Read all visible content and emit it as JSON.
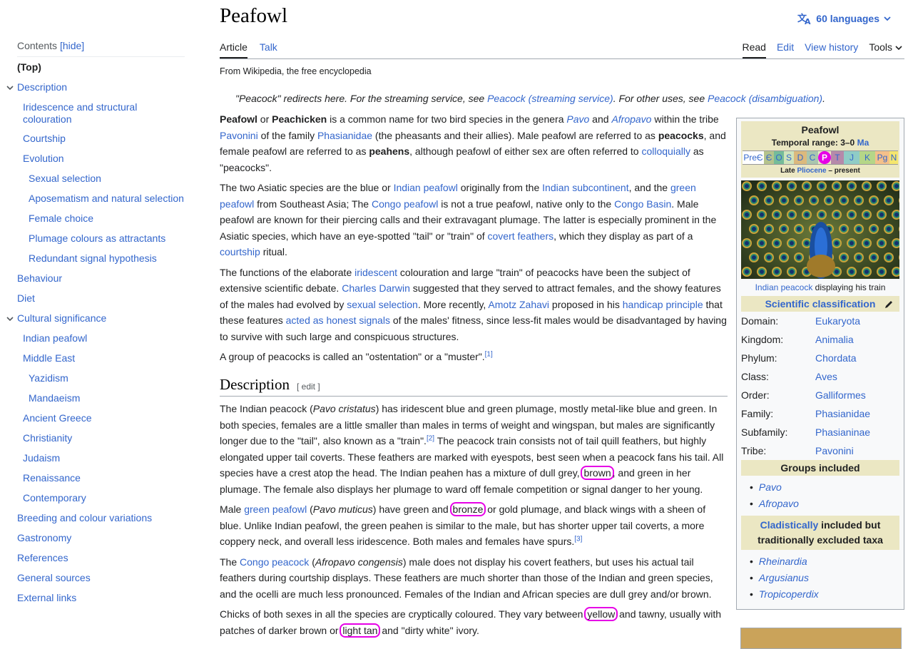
{
  "toc": {
    "heading": "Contents",
    "hide_label": "[hide]",
    "items": [
      {
        "label": "(Top)"
      },
      {
        "label": "Description"
      },
      {
        "label": "Iridescence and structural colouration"
      },
      {
        "label": "Courtship"
      },
      {
        "label": "Evolution"
      },
      {
        "label": "Sexual selection"
      },
      {
        "label": "Aposematism and natural selection"
      },
      {
        "label": "Female choice"
      },
      {
        "label": "Plumage colours as attractants"
      },
      {
        "label": "Redundant signal hypothesis"
      },
      {
        "label": "Behaviour"
      },
      {
        "label": "Diet"
      },
      {
        "label": "Cultural significance"
      },
      {
        "label": "Indian peafowl"
      },
      {
        "label": "Middle East"
      },
      {
        "label": "Yazidism"
      },
      {
        "label": "Mandaeism"
      },
      {
        "label": "Ancient Greece"
      },
      {
        "label": "Christianity"
      },
      {
        "label": "Judaism"
      },
      {
        "label": "Renaissance"
      },
      {
        "label": "Contemporary"
      },
      {
        "label": "Breeding and colour variations"
      },
      {
        "label": "Gastronomy"
      },
      {
        "label": "References"
      },
      {
        "label": "General sources"
      },
      {
        "label": "External links"
      }
    ]
  },
  "header": {
    "title": "Peafowl",
    "languages": "60 languages",
    "tabs_left": [
      "Article",
      "Talk"
    ],
    "tabs_right": [
      "Read",
      "Edit",
      "View history",
      "Tools"
    ],
    "tagline": "From Wikipedia, the free encyclopedia",
    "hatnote": {
      "a": "\"Peacock\" redirects here. For the streaming service, see ",
      "link1": "Peacock (streaming service)",
      "b": ". For other uses, see ",
      "link2": "Peacock (disambiguation)",
      "c": "."
    }
  },
  "article": {
    "p1": {
      "t1": "Peafowl",
      "t2": " or ",
      "t3": "Peachicken",
      "t4": " is a common name for two bird species in the genera ",
      "pavo": "Pavo",
      "t5": " and ",
      "afropavo": "Afropavo",
      "t6": " within the tribe ",
      "pavonini": "Pavonini",
      "t7": " of the family ",
      "phasianidae": "Phasianidae",
      "t8": " (the pheasants and their allies). Male peafowl are referred to as ",
      "peacocks": "peacocks",
      "t9": ", and female peafowl are referred to as ",
      "peahens": "peahens",
      "t10": ", although peafowl of either sex are often referred to ",
      "colloquially": "colloquially",
      "t11": " as \"peacocks\"."
    },
    "p2": {
      "t1": "The two Asiatic species are the blue or ",
      "indian_peafowl": "Indian peafowl",
      "t2": " originally from the ",
      "subcontinent": "Indian subcontinent",
      "t3": ", and the ",
      "green_peafowl": "green peafowl",
      "t4": " from Southeast Asia; The ",
      "congo_peafowl": "Congo peafowl",
      "t5": " is not a true peafowl, native only to the ",
      "congo_basin": "Congo Basin",
      "t6": ". Male peafowl are known for their piercing calls and their extravagant plumage. The latter is especially prominent in the Asiatic species, which have an eye-spotted \"tail\" or \"train\" of ",
      "covert": "covert feathers",
      "t7": ", which they display as part of a ",
      "courtship": "courtship",
      "t8": " ritual."
    },
    "p3": {
      "t1": "The functions of the elaborate ",
      "iridescent": "iridescent",
      "t2": " colouration and large \"train\" of peacocks have been the subject of extensive scientific debate. ",
      "darwin": "Charles Darwin",
      "t3": " suggested that they served to attract females, and the showy features of the males had evolved by ",
      "sexual_selection": "sexual selection",
      "t4": ". More recently, ",
      "zahavi": "Amotz Zahavi",
      "t5": " proposed in his ",
      "handicap": "handicap principle",
      "t6": " that these features ",
      "honest": "acted as honest signals",
      "t7": " of the males' fitness, since less-fit males would be disadvantaged by having to survive with such large and conspicuous structures."
    },
    "p4": {
      "t1": "A group of peacocks is called an \"ostentation\" or a \"muster\".",
      "ref": "[1]"
    },
    "description_heading": "Description",
    "edit_label": "[ edit ]",
    "d1": {
      "t1": "The Indian peacock (",
      "sci": "Pavo cristatus",
      "t2": ") has iridescent blue and green plumage, mostly metal-like blue and green. In both species, females are a little smaller than males in terms of weight and wingspan, but males are significantly longer due to the \"tail\", also known as a \"train\".",
      "ref": "[2]",
      "t3": " The peacock train consists not of tail quill feathers, but highly elongated upper tail coverts. These feathers are marked with eyespots, best seen when a peacock fans his tail. All species have a crest atop the head. The Indian peahen has a mixture of dull grey, ",
      "brown": "brown",
      "t4": ", and green in her plumage. The female also displays her plumage to ward off female competition or signal danger to her young."
    },
    "d2": {
      "t1": "Male ",
      "green": "green peafowl",
      "t2": " (",
      "sci": "Pavo muticus",
      "t3": ") have green and ",
      "bronze": "bronze",
      "t4": " or gold plumage, and black wings with a sheen of blue. Unlike Indian peafowl, the green peahen is similar to the male, but has shorter upper tail coverts, a more coppery neck, and overall less iridescence. Both males and females have spurs.",
      "ref": "[3]"
    },
    "d3": {
      "t1": "The ",
      "congo": "Congo peacock",
      "t2": " (",
      "sci": "Afropavo congensis",
      "t3": ") male does not display his covert feathers, but uses his actual tail feathers during courtship displays. These feathers are much shorter than those of the Indian and green species, and the ocelli are much less pronounced. Females of the Indian and African species are dull grey and/or brown."
    },
    "d4": {
      "t1": "Chicks of both sexes in all the species are cryptically coloured. They vary between ",
      "yellow": "yellow",
      "t2": " and tawny, usually with patches of darker brown or ",
      "light_tan": "light tan",
      "t3": " and \"dirty white\" ivory."
    }
  },
  "infobox": {
    "name": "Peafowl",
    "range_label": "Temporal range: 3–0 ",
    "range_unit": "Ma",
    "timeline": [
      "PreЄ",
      "Є",
      "O",
      "S",
      "D",
      "C",
      "P",
      "T",
      "J",
      "K",
      "Pg",
      "N"
    ],
    "late": "Late ",
    "pliocene": "Pliocene",
    "present": " – present",
    "caption_link": "Indian peacock",
    "caption_rest": " displaying his train",
    "classification_heading": "Scientific classification",
    "rows": [
      {
        "k": "Domain:",
        "v": "Eukaryota"
      },
      {
        "k": "Kingdom:",
        "v": "Animalia"
      },
      {
        "k": "Phylum:",
        "v": "Chordata"
      },
      {
        "k": "Class:",
        "v": "Aves"
      },
      {
        "k": "Order:",
        "v": "Galliformes"
      },
      {
        "k": "Family:",
        "v": "Phasianidae"
      },
      {
        "k": "Subfamily:",
        "v": "Phasianinae"
      },
      {
        "k": "Tribe:",
        "v": "Pavonini"
      }
    ],
    "groups_heading": "Groups included",
    "groups": [
      "Pavo",
      "Afropavo"
    ],
    "clad_link": "Cladistically",
    "clad_rest": " included but traditionally excluded taxa",
    "excluded": [
      "Rheinardia",
      "Argusianus",
      "Tropicoperdix"
    ]
  },
  "colors": {
    "link": "#3366cc",
    "highlight": "#e600e6",
    "infobox_band": "#ebe7c3"
  }
}
